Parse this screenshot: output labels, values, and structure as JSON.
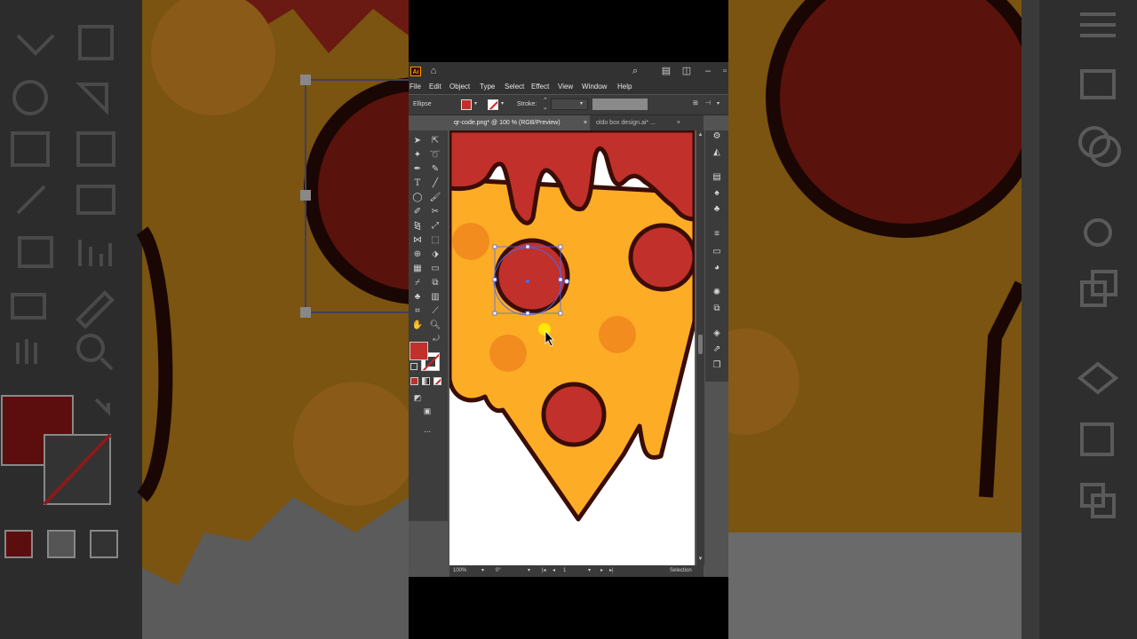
{
  "app": {
    "logo": "Ai",
    "title_icons": [
      "home-icon",
      "search-icon",
      "arrange-documents-icon",
      "workspace-icon",
      "minimize-icon",
      "restore-icon"
    ]
  },
  "menu": {
    "items": [
      "File",
      "Edit",
      "Object",
      "Type",
      "Select",
      "Effect",
      "View",
      "Window",
      "Help"
    ]
  },
  "control_bar": {
    "object_type": "Ellipse",
    "fill_color": "#c1302a",
    "stroke_label": "Stroke:"
  },
  "tabs": [
    {
      "label": "qr-code.png* @ 100 % (RGB/Preview)",
      "close": "×"
    },
    {
      "label": "oldo box design.ai* ...",
      "close": "×"
    }
  ],
  "toolbox": {
    "fill_color": "#c1302a",
    "more_tools": "..."
  },
  "status": {
    "zoom": "100%",
    "rotation": "0°",
    "artboard_number": "1",
    "tool_name": "Selection"
  },
  "colors": {
    "sauce": "#c1302a",
    "cheese": "#fdac26",
    "spot": "#f28c1e",
    "outline": "#3a0d07",
    "selection": "#4a6cf0"
  }
}
